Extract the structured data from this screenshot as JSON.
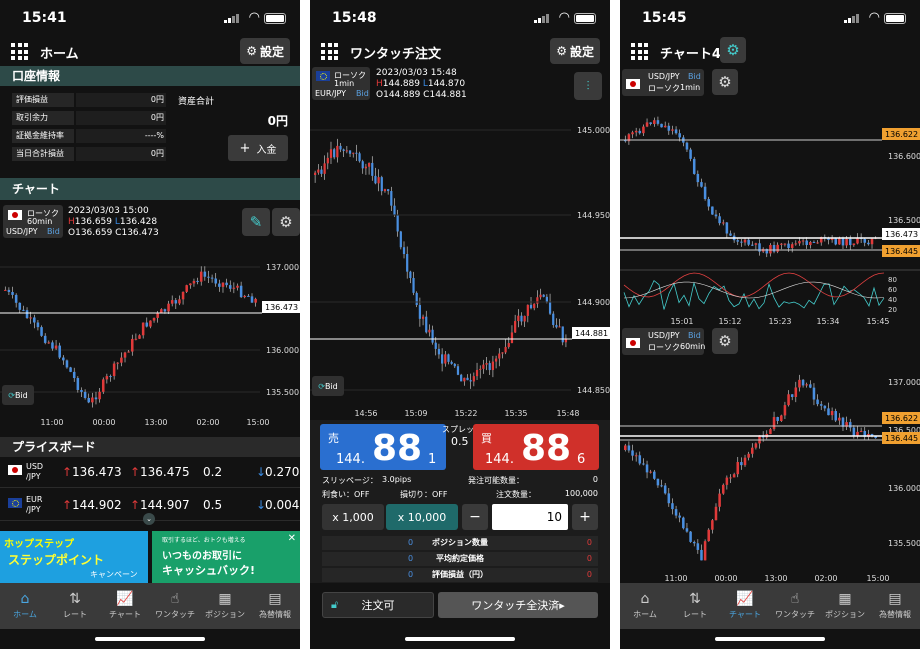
{
  "p1": {
    "time": "15:41",
    "title": "ホーム",
    "settings": "設定",
    "account_section": "口座情報",
    "account_rows": [
      {
        "label": "評価損益",
        "value": "0円"
      },
      {
        "label": "取引余力",
        "value": "0円"
      },
      {
        "label": "証拠金維持率",
        "value": "----%"
      },
      {
        "label": "当日合計損益",
        "value": "0円"
      }
    ],
    "asset_label": "資産合計",
    "asset_value": "0円",
    "deposit": "入金",
    "chart_section": "チャート",
    "sym": {
      "type": "ローソク",
      "tf": "60min",
      "pair": "USD/JPY",
      "side": "Bid"
    },
    "ohlc": {
      "date": "2023/03/03 15:00",
      "h": "136.659",
      "l": "136.428",
      "o": "136.659",
      "c": "136.473"
    },
    "price_labels": [
      "137.000",
      "136.500",
      "136.000",
      "135.500"
    ],
    "last_tag": "136.473",
    "time_labels": [
      "11:00",
      "00:00",
      "13:00",
      "02:00",
      "15:00"
    ],
    "bid_label": "Bid",
    "priceboard_section": "プライスボード",
    "pb": [
      {
        "pair": "USD\n/JPY",
        "bid": "136.473",
        "ask": "136.475",
        "spread": "0.2",
        "chg": "0.270"
      },
      {
        "pair": "EUR\n/JPY",
        "bid": "144.902",
        "ask": "144.907",
        "spread": "0.5",
        "chg": "0.004"
      }
    ],
    "ad_left_title": "ホップステップ",
    "ad_left_sub": "ステップポイント",
    "ad_left_cap": "キャンペーン",
    "ad_right_1": "取引するほど、おトクも増える",
    "ad_right_2": "いつものお取引に",
    "ad_right_3": "キャッシュバック!"
  },
  "p2": {
    "time": "15:48",
    "title": "ワンタッチ注文",
    "settings": "設定",
    "sym": {
      "type": "ローソク",
      "tf": "1min",
      "pair": "EUR/JPY",
      "side": "Bid"
    },
    "ohlc": {
      "date": "2023/03/03 15:48",
      "h": "144.889",
      "l": "144.870",
      "o": "144.889",
      "c": "144.881"
    },
    "price_labels": [
      "145.000",
      "144.950",
      "144.900",
      "144.850"
    ],
    "last_tag": "144.881",
    "time_labels": [
      "14:56",
      "15:09",
      "15:22",
      "15:35",
      "15:48"
    ],
    "bid_label": "Bid",
    "sell": {
      "label": "売",
      "pre": "144.",
      "big": "88",
      "small": "1"
    },
    "buy": {
      "label": "買",
      "pre": "144.",
      "big": "88",
      "small": "6"
    },
    "spread_label": "スプレッド",
    "spread": "0.5",
    "slippage_label": "スリッページ：",
    "slippage": "3.0pips",
    "orderable_label": "発注可能数量：",
    "orderable": "0",
    "tp_label": "利食い：OFF",
    "sl_label": "損切り：OFF",
    "qty_label": "注文数量：",
    "qty_max": "100,000",
    "mult_1": "x 1,000",
    "mult_2": "x 10,000",
    "qty": "10",
    "minus": "−",
    "plus": "+",
    "rows": [
      {
        "l": "0",
        "label": "ポジション数量",
        "r": "0"
      },
      {
        "l": "0",
        "label": "平均約定価格",
        "r": "0"
      },
      {
        "l": "0",
        "label": "評価損益（円）",
        "r": "0"
      }
    ],
    "order_ok": "注文可",
    "close_all": "ワンタッチ全決済"
  },
  "p3": {
    "time": "15:45",
    "title": "チャート4",
    "c1": {
      "pair": "USD/JPY",
      "side": "Bid",
      "type": "ローソク",
      "tf": "1min",
      "price_labels": [
        "136.600",
        "136.500"
      ],
      "tags": [
        "136.622",
        "136.473",
        "136.445"
      ],
      "osc": [
        "80",
        "60",
        "40",
        "20"
      ],
      "time_labels": [
        "15:01",
        "15:12",
        "15:23",
        "15:34",
        "15:45"
      ]
    },
    "c2": {
      "pair": "USD/JPY",
      "side": "Bid",
      "type": "ローソク",
      "tf": "60min",
      "price_labels": [
        "137.000",
        "136.500",
        "136.000",
        "135.500"
      ],
      "tags": [
        "136.622",
        "136.445"
      ],
      "time_labels": [
        "11:00",
        "00:00",
        "13:00",
        "02:00",
        "15:00"
      ]
    }
  },
  "tabs": [
    {
      "icon": "⌂",
      "label": "ホーム"
    },
    {
      "icon": "⇅",
      "label": "レート"
    },
    {
      "icon": "📈",
      "label": "チャート"
    },
    {
      "icon": "☝",
      "label": "ワンタッチ"
    },
    {
      "icon": "▦",
      "label": "ポジション"
    },
    {
      "icon": "▤",
      "label": "為替情報"
    }
  ],
  "colors": {
    "up": "#e03a3a",
    "down": "#4a8fe0",
    "accent": "#2d4a48",
    "tag": "#f0a030",
    "active_tab": "#4aa6e0"
  }
}
